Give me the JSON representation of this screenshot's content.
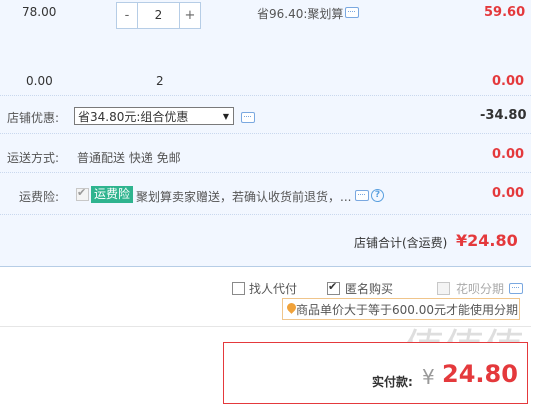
{
  "item_row": {
    "unit_price": "78.00",
    "qty_minus": "-",
    "qty_value": "2",
    "qty_plus": "+",
    "promo": "省96.40:聚划算",
    "subtotal": "59.60"
  },
  "summary_row": {
    "unit_price": "0.00",
    "qty": "2",
    "subtotal": "0.00"
  },
  "shop_discount": {
    "label": "店铺优惠:",
    "selected": "省34.80元:组合优惠",
    "amount": "-34.80"
  },
  "shipping": {
    "label": "运送方式:",
    "method": "普通配送 快递 免邮",
    "amount": "0.00"
  },
  "insurance": {
    "label": "运费险:",
    "tag": "运费险",
    "text": "聚划算卖家赠送，若确认收货前退货，...",
    "amount": "0.00"
  },
  "shop_total": {
    "label": "店铺合计(含运费)",
    "value": "¥24.80"
  },
  "options": {
    "proxy_pay": "找人代付",
    "anonymous": "匿名购买",
    "installment": "花呗分期"
  },
  "tip": "商品单价大于等于600.00元才能使用分期",
  "payment": {
    "label": "实付款:",
    "currency": "¥",
    "value": "24.80"
  },
  "watermark": "值值值",
  "colors": {
    "accent_red": "#e4393c",
    "panel_blue": "#f2f7ff",
    "tag_green": "#2fb48f"
  }
}
